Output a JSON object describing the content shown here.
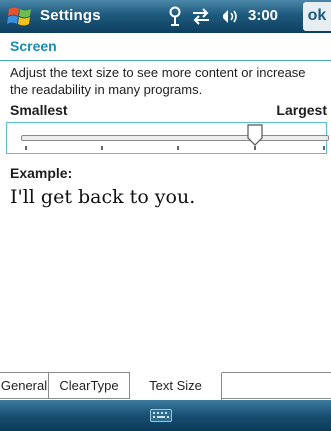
{
  "titlebar": {
    "title": "Settings",
    "clock": "3:00",
    "ok_label": "ok",
    "icons": [
      "windows-start-icon",
      "connectivity-icon",
      "sync-arrows-icon",
      "volume-icon"
    ]
  },
  "page": {
    "heading": "Screen",
    "description": "Adjust the text size to see more content or increase the readability in many programs."
  },
  "slider": {
    "min_label": "Smallest",
    "max_label": "Largest",
    "steps": 5,
    "selected_step": 4
  },
  "example": {
    "label": "Example:",
    "text": "I'll get back to you."
  },
  "tabs": [
    {
      "label": "General",
      "active": false
    },
    {
      "label": "ClearType",
      "active": false
    },
    {
      "label": "Text Size",
      "active": true
    }
  ],
  "bottombar": {
    "icon": "keyboard-icon"
  },
  "colors": {
    "titlebar": "#1e5a7d",
    "heading": "#188cb0",
    "accent_border": "#58c0d8"
  }
}
